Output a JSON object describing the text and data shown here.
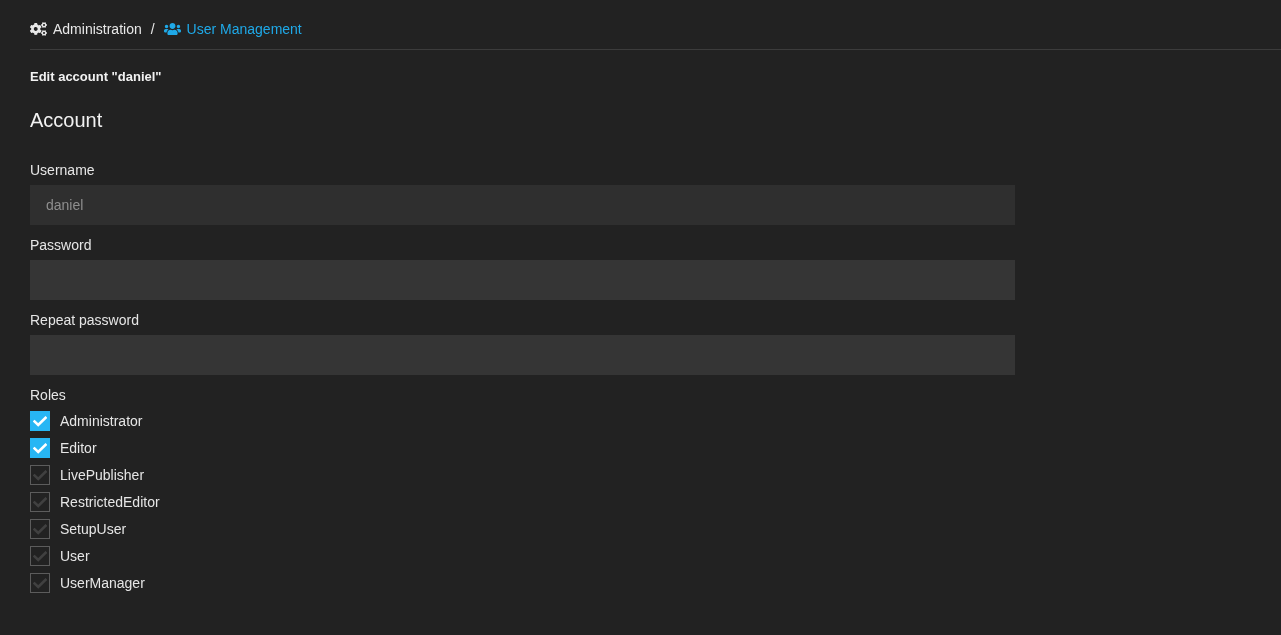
{
  "breadcrumb": {
    "items": [
      {
        "label": "Administration",
        "kind": "root"
      },
      {
        "label": "User Management",
        "kind": "link"
      }
    ],
    "separator": "/"
  },
  "page_title": "Edit account \"daniel\"",
  "section_title": "Account",
  "fields": [
    {
      "label": "Username",
      "value": "daniel",
      "disabled": true
    },
    {
      "label": "Password"
    },
    {
      "label": "Repeat password"
    }
  ],
  "roles": {
    "label": "Roles",
    "items": [
      {
        "label": "Administrator",
        "checked": true
      },
      {
        "label": "Editor",
        "checked": true
      },
      {
        "label": "LivePublisher",
        "checked": false
      },
      {
        "label": "RestrictedEditor",
        "checked": false
      },
      {
        "label": "SetupUser",
        "checked": false
      },
      {
        "label": "User",
        "checked": false
      },
      {
        "label": "UserManager",
        "checked": false
      }
    ]
  }
}
